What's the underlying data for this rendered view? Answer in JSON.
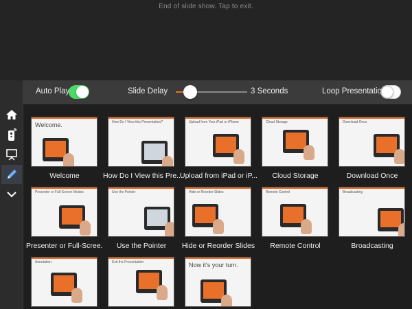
{
  "app": {
    "exit_message": "End of slide show.  Tap to exit."
  },
  "sidebar": {
    "items": [
      {
        "name": "home",
        "icon": "home-icon"
      },
      {
        "name": "remote",
        "icon": "remote-icon"
      },
      {
        "name": "presentation",
        "icon": "presentation-icon"
      },
      {
        "name": "pen",
        "icon": "pen-icon",
        "active": true
      },
      {
        "name": "more",
        "icon": "chevron-down-icon"
      }
    ]
  },
  "controls": {
    "auto_play_label": "Auto Play",
    "auto_play_on": true,
    "slide_delay_label": "Slide Delay",
    "slide_delay_value": "3 Seconds",
    "slide_delay_fraction": 0.2,
    "loop_label": "Loop Presentation",
    "loop_on": false
  },
  "colors": {
    "accent": "#e8702a",
    "toggle_on": "#4cd964"
  },
  "slides": [
    {
      "caption": "Welcome",
      "title": "Welcome."
    },
    {
      "caption": "How Do I View this Pre...",
      "title": "How Do I View this Presentation?"
    },
    {
      "caption": "Upload from iPad or iP...",
      "title": "Upload from Your iPad or iPhone"
    },
    {
      "caption": "Cloud Storage",
      "title": "Cloud Storage"
    },
    {
      "caption": "Download Once",
      "title": "Download Once"
    },
    {
      "caption": "Presenter or Full-Scree...",
      "title": "Presenter or Full-Screen Modes"
    },
    {
      "caption": "Use the Pointer",
      "title": "Use the Pointer"
    },
    {
      "caption": "Hide or Reorder Slides",
      "title": "Hide or Reorder Slides"
    },
    {
      "caption": "Remote Control",
      "title": "Remote Control"
    },
    {
      "caption": "Broadcasting",
      "title": "Broadcasting"
    },
    {
      "caption": "",
      "title": "Annotation"
    },
    {
      "caption": "",
      "title": "Exit the Presentation"
    },
    {
      "caption": "",
      "title": "Now it's your turn."
    }
  ]
}
